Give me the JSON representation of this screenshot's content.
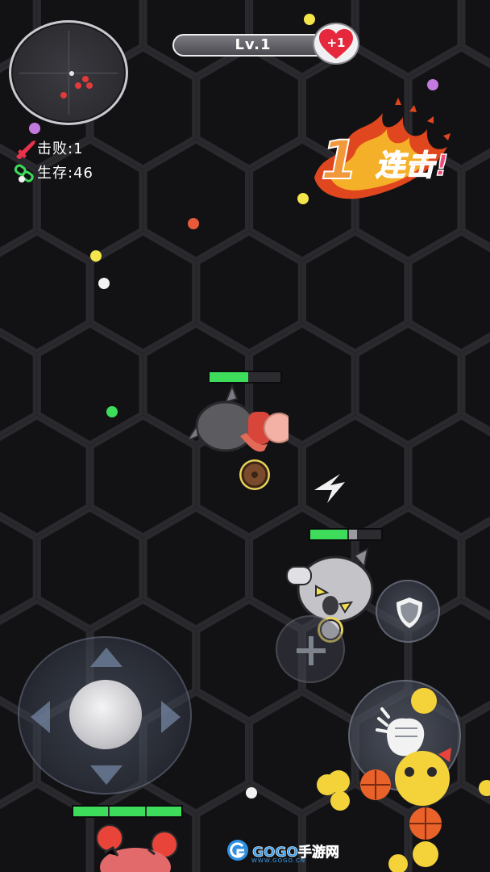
{
  "hud": {
    "level_label": "Lv.1",
    "heart_badge": "+1",
    "kills_label": "击败:1",
    "survivors_label": "生存:46"
  },
  "combo": {
    "count": "1",
    "text": "连击!"
  },
  "health": {
    "player_hammer": 0.5,
    "player_wolf": 0.56,
    "player_bottom": 1.0
  },
  "watermark": {
    "brand": "GOGO手游网",
    "url": "WWW.GOGO.CN"
  },
  "colors": {
    "background": "#0c0c0e",
    "hex_line": "#2a2a2e",
    "health_green": "#3ddc5a",
    "combo_orange": "#f0983a",
    "combo_pink": "#f04a7a",
    "heart_red": "#e6283c"
  },
  "icons": {
    "kills": "sword-icon",
    "survivors": "chain-icon",
    "shield": "shield-icon",
    "attack": "fist-icon",
    "add": "plus-icon"
  }
}
